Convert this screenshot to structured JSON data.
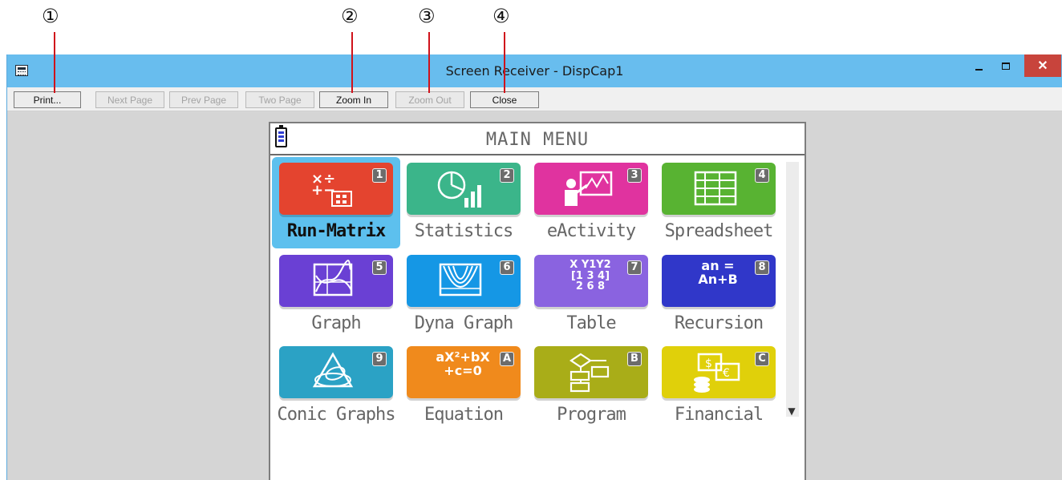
{
  "callouts": [
    "①",
    "②",
    "③",
    "④"
  ],
  "window": {
    "title": "Screen Receiver - DispCap1",
    "close_glyph": "✕"
  },
  "toolbar": {
    "print": "Print...",
    "next_page": "Next Page",
    "prev_page": "Prev Page",
    "two_page": "Two Page",
    "zoom_in": "Zoom In",
    "zoom_out": "Zoom Out",
    "close": "Close"
  },
  "calc": {
    "title": "MAIN MENU",
    "scroll_arrow": "▼",
    "tiles": [
      {
        "num": "1",
        "label": "Run-Matrix",
        "color": "#e4442f",
        "icon": "run-matrix-icon",
        "selected": true
      },
      {
        "num": "2",
        "label": "Statistics",
        "color": "#3bb58a",
        "icon": "statistics-icon"
      },
      {
        "num": "3",
        "label": "eActivity",
        "color": "#e0339f",
        "icon": "eactivity-icon"
      },
      {
        "num": "4",
        "label": "Spreadsheet",
        "color": "#58b332",
        "icon": "spreadsheet-icon"
      },
      {
        "num": "5",
        "label": "Graph",
        "color": "#6a40d4",
        "icon": "graph-icon"
      },
      {
        "num": "6",
        "label": "Dyna Graph",
        "color": "#1597e5",
        "icon": "dyna-graph-icon"
      },
      {
        "num": "7",
        "label": "Table",
        "color": "#8a63e0",
        "icon": "table-icon",
        "icon_text": [
          "X Y1Y2",
          "[1 3 4]",
          " 2 6 8"
        ]
      },
      {
        "num": "8",
        "label": "Recursion",
        "color": "#3037c9",
        "icon": "recursion-icon",
        "icon_text": [
          "an =",
          "An+B"
        ]
      },
      {
        "num": "9",
        "label": "Conic Graphs",
        "color": "#2ba2c5",
        "icon": "conic-graphs-icon"
      },
      {
        "num": "A",
        "label": "Equation",
        "color": "#f08a1c",
        "icon": "equation-icon",
        "icon_text": [
          "aX²+bX",
          "+c=0"
        ]
      },
      {
        "num": "B",
        "label": "Program",
        "color": "#a9ad18",
        "icon": "program-icon"
      },
      {
        "num": "C",
        "label": "Financial",
        "color": "#e0d00a",
        "icon": "financial-icon"
      }
    ]
  }
}
